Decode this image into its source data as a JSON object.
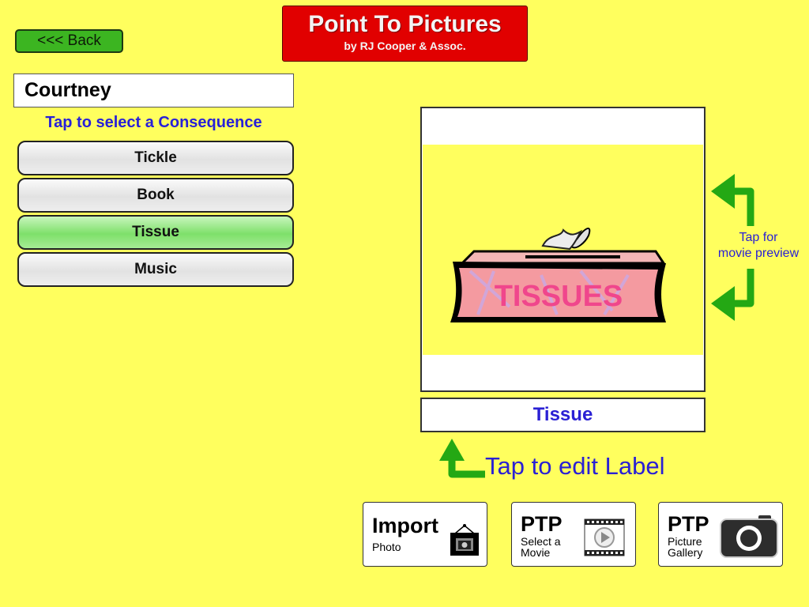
{
  "header": {
    "back_label": "<<< Back",
    "app_title": "Point To Pictures",
    "app_subtitle": "by RJ Cooper & Assoc."
  },
  "student": {
    "name": "Courtney"
  },
  "consequences": {
    "instruction": "Tap to select a Consequence",
    "items": [
      {
        "label": "Tickle",
        "selected": false
      },
      {
        "label": "Book",
        "selected": false
      },
      {
        "label": "Tissue",
        "selected": true
      },
      {
        "label": "Music",
        "selected": false
      }
    ]
  },
  "preview": {
    "image_subject": "tissue-box",
    "image_text": "TISSUES",
    "label": "Tissue",
    "movie_hint_line1": "Tap for",
    "movie_hint_line2": "movie preview",
    "edit_hint": "Tap to edit Label"
  },
  "tools": [
    {
      "title": "Import",
      "subtitle_line1": "Photo",
      "subtitle_line2": "",
      "icon": "framed-photo-icon"
    },
    {
      "title": "PTP",
      "subtitle_line1": "Select a",
      "subtitle_line2": "Movie",
      "icon": "film-play-icon"
    },
    {
      "title": "PTP",
      "subtitle_line1": "Picture",
      "subtitle_line2": "Gallery",
      "icon": "camera-icon"
    }
  ],
  "colors": {
    "background": "#ffff5e",
    "accent_green": "#3cb521",
    "title_red": "#e10000",
    "hint_blue": "#2a20d4",
    "selected_green": "#7ee06a"
  }
}
